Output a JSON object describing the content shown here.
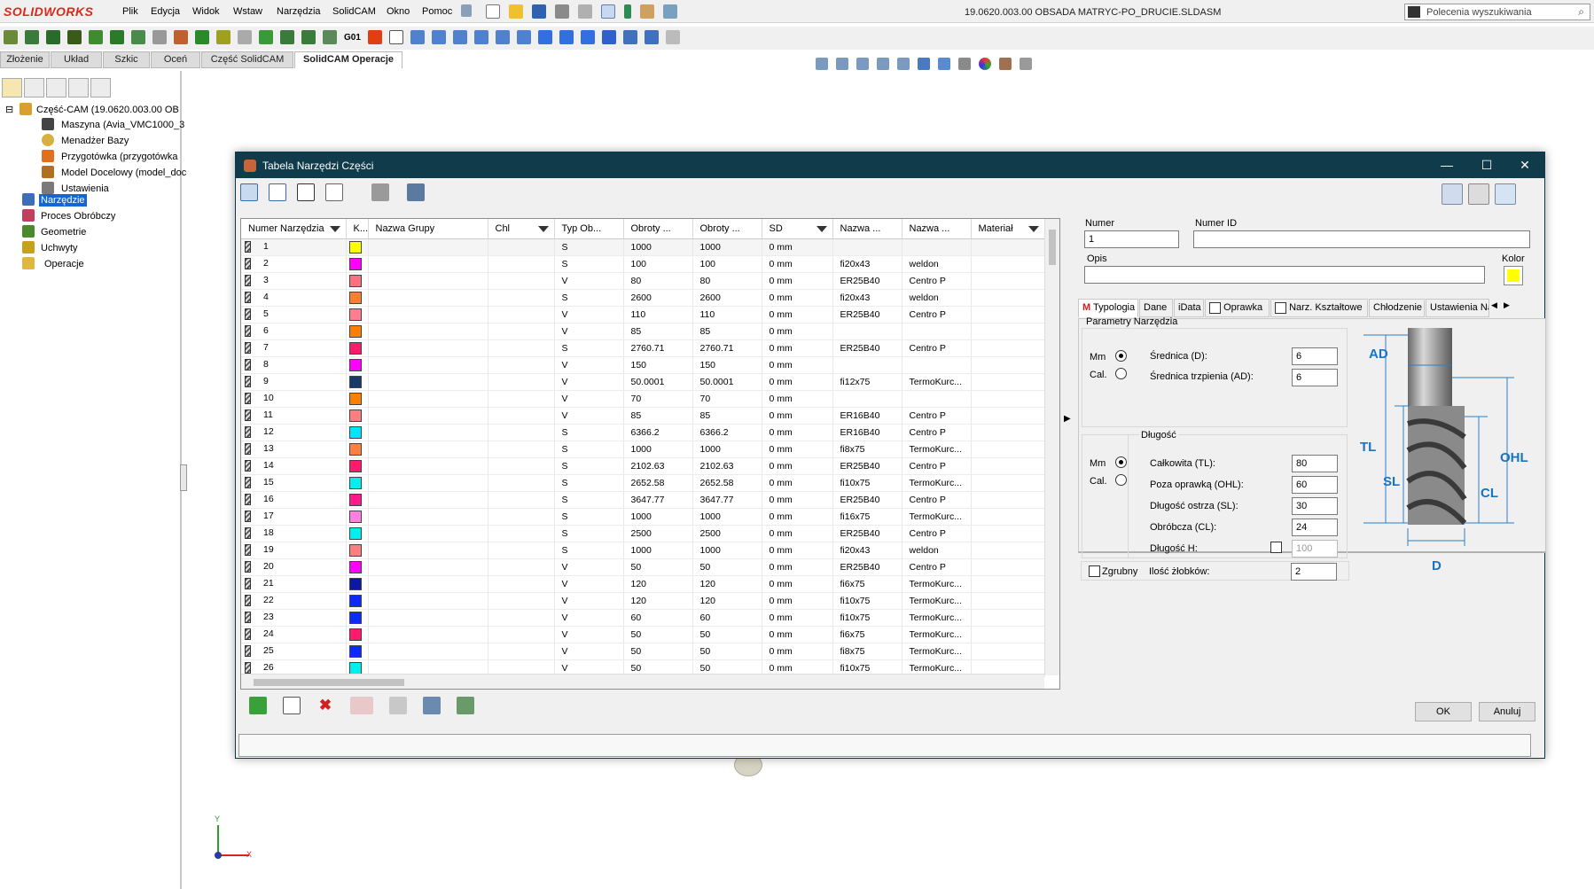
{
  "app": {
    "logo_text": "SOLIDWORKS",
    "menu": [
      "Plik",
      "Edycja",
      "Widok",
      "Wstaw",
      "Narzędzia",
      "SolidCAM",
      "Okno",
      "Pomoc"
    ],
    "document_title": "19.0620.003.00 OBSADA MATRYC-PO_DRUCIE.SLDASM",
    "search_placeholder": "Polecenia wyszukiwania",
    "toolbar_g01": "G01"
  },
  "command_tabs": [
    "Złożenie",
    "Układ",
    "Szkic",
    "Oceń",
    "Część SolidCAM",
    "SolidCAM Operacje"
  ],
  "command_tabs_active": "SolidCAM Operacje",
  "tree": {
    "root": "Część-CAM (19.0620.003.00 OB",
    "items": [
      {
        "label": "Maszyna (Avia_VMC1000_3",
        "icon": "machine-icon"
      },
      {
        "label": "Menadżer Bazy",
        "icon": "coordinate-system-icon"
      },
      {
        "label": "Przygotówka (przygotówka",
        "icon": "stock-icon"
      },
      {
        "label": "Model Docelowy (model_doc",
        "icon": "target-model-icon"
      },
      {
        "label": "Ustawienia",
        "icon": "settings-icon"
      }
    ],
    "top_items": [
      {
        "label": "Narzędzie",
        "icon": "tools-icon",
        "selected": true
      },
      {
        "label": "Proces Obróbczy",
        "icon": "process-icon"
      },
      {
        "label": "Geometrie",
        "icon": "geometry-icon"
      },
      {
        "label": "Uchwyty",
        "icon": "fixtures-icon"
      },
      {
        "label": "Operacje",
        "icon": "operations-folder-icon"
      }
    ]
  },
  "dialog": {
    "title": "Tabela Narzędzi Części",
    "columns": [
      "Numer Narzędzia",
      "K...",
      "Nazwa Grupy",
      "Chl",
      "Typ Ob...",
      "Obroty ...",
      "Obroty ...",
      "SD",
      "Nazwa ...",
      "Nazwa ...",
      "Materiał"
    ],
    "rows": [
      {
        "num": "1",
        "color": "#ffff00",
        "typ": "S",
        "o1": "1000",
        "o2": "1000",
        "sd": "0 mm",
        "n1": "",
        "n2": ""
      },
      {
        "num": "2",
        "color": "#ff00ff",
        "typ": "S",
        "o1": "100",
        "o2": "100",
        "sd": "0 mm",
        "n1": "fi20x43",
        "n2": "weldon"
      },
      {
        "num": "3",
        "color": "#ff7080",
        "typ": "V",
        "o1": "80",
        "o2": "80",
        "sd": "0 mm",
        "n1": "ER25B40",
        "n2": "Centro P"
      },
      {
        "num": "4",
        "color": "#ff7f30",
        "typ": "S",
        "o1": "2600",
        "o2": "2600",
        "sd": "0 mm",
        "n1": "fi20x43",
        "n2": "weldon"
      },
      {
        "num": "5",
        "color": "#ff7f90",
        "typ": "V",
        "o1": "110",
        "o2": "110",
        "sd": "0 mm",
        "n1": "ER25B40",
        "n2": "Centro P"
      },
      {
        "num": "6",
        "color": "#ff8000",
        "typ": "V",
        "o1": "85",
        "o2": "85",
        "sd": "0 mm",
        "n1": "",
        "n2": ""
      },
      {
        "num": "7",
        "color": "#ff1a6e",
        "typ": "S",
        "o1": "2760.71",
        "o2": "2760.71",
        "sd": "0 mm",
        "n1": "ER25B40",
        "n2": "Centro P"
      },
      {
        "num": "8",
        "color": "#ff00ff",
        "typ": "V",
        "o1": "150",
        "o2": "150",
        "sd": "0 mm",
        "n1": "",
        "n2": ""
      },
      {
        "num": "9",
        "color": "#173a6b",
        "typ": "V",
        "o1": "50.0001",
        "o2": "50.0001",
        "sd": "0 mm",
        "n1": "fi12x75",
        "n2": "TermoKurc..."
      },
      {
        "num": "10",
        "color": "#ff8000",
        "typ": "V",
        "o1": "70",
        "o2": "70",
        "sd": "0 mm",
        "n1": "",
        "n2": ""
      },
      {
        "num": "11",
        "color": "#ff7f80",
        "typ": "V",
        "o1": "85",
        "o2": "85",
        "sd": "0 mm",
        "n1": "ER16B40",
        "n2": "Centro P"
      },
      {
        "num": "12",
        "color": "#00e5ff",
        "typ": "S",
        "o1": "6366.2",
        "o2": "6366.2",
        "sd": "0 mm",
        "n1": "ER16B40",
        "n2": "Centro P"
      },
      {
        "num": "13",
        "color": "#ff8040",
        "typ": "S",
        "o1": "1000",
        "o2": "1000",
        "sd": "0 mm",
        "n1": "fi8x75",
        "n2": "TermoKurc..."
      },
      {
        "num": "14",
        "color": "#ff1a6e",
        "typ": "S",
        "o1": "2102.63",
        "o2": "2102.63",
        "sd": "0 mm",
        "n1": "ER25B40",
        "n2": "Centro P"
      },
      {
        "num": "15",
        "color": "#00f0f0",
        "typ": "S",
        "o1": "2652.58",
        "o2": "2652.58",
        "sd": "0 mm",
        "n1": "fi10x75",
        "n2": "TermoKurc..."
      },
      {
        "num": "16",
        "color": "#ff1a8c",
        "typ": "S",
        "o1": "3647.77",
        "o2": "3647.77",
        "sd": "0 mm",
        "n1": "ER25B40",
        "n2": "Centro P"
      },
      {
        "num": "17",
        "color": "#ff80e0",
        "typ": "S",
        "o1": "1000",
        "o2": "1000",
        "sd": "0 mm",
        "n1": "fi16x75",
        "n2": "TermoKurc..."
      },
      {
        "num": "18",
        "color": "#00f0f0",
        "typ": "S",
        "o1": "2500",
        "o2": "2500",
        "sd": "0 mm",
        "n1": "ER25B40",
        "n2": "Centro P"
      },
      {
        "num": "19",
        "color": "#ff7f80",
        "typ": "S",
        "o1": "1000",
        "o2": "1000",
        "sd": "0 mm",
        "n1": "fi20x43",
        "n2": "weldon"
      },
      {
        "num": "20",
        "color": "#ff00ff",
        "typ": "V",
        "o1": "50",
        "o2": "50",
        "sd": "0 mm",
        "n1": "ER25B40",
        "n2": "Centro P"
      },
      {
        "num": "21",
        "color": "#0a1a9e",
        "typ": "V",
        "o1": "120",
        "o2": "120",
        "sd": "0 mm",
        "n1": "fi6x75",
        "n2": "TermoKurc..."
      },
      {
        "num": "22",
        "color": "#0a2aff",
        "typ": "V",
        "o1": "120",
        "o2": "120",
        "sd": "0 mm",
        "n1": "fi10x75",
        "n2": "TermoKurc..."
      },
      {
        "num": "23",
        "color": "#0a2aff",
        "typ": "V",
        "o1": "60",
        "o2": "60",
        "sd": "0 mm",
        "n1": "fi10x75",
        "n2": "TermoKurc..."
      },
      {
        "num": "24",
        "color": "#ff1a6e",
        "typ": "V",
        "o1": "50",
        "o2": "50",
        "sd": "0 mm",
        "n1": "fi6x75",
        "n2": "TermoKurc..."
      },
      {
        "num": "25",
        "color": "#0a2aff",
        "typ": "V",
        "o1": "50",
        "o2": "50",
        "sd": "0 mm",
        "n1": "fi8x75",
        "n2": "TermoKurc..."
      },
      {
        "num": "26",
        "color": "#00f0f0",
        "typ": "V",
        "o1": "50",
        "o2": "50",
        "sd": "0 mm",
        "n1": "fi10x75",
        "n2": "TermoKurc..."
      }
    ],
    "fields": {
      "numer_label": "Numer",
      "numer_value": "1",
      "numer_id_label": "Numer ID",
      "numer_id_value": "",
      "opis_label": "Opis",
      "opis_value": "",
      "kolor_label": "Kolor",
      "kolor_value": "#ffff00"
    },
    "detail_tabs": [
      "Typologia",
      "Dane",
      "iData",
      "Oprawka",
      "Narz. Kształtowe",
      "Chłodzenie",
      "Ustawienia Na"
    ],
    "params": {
      "group_label": "Parametry Narzędzia",
      "mm_label": "Mm",
      "cal_label": "Cal.",
      "srednica_label": "Średnica (D):",
      "srednica_value": "6",
      "trzpien_label": "Średnica trzpienia (AD):",
      "trzpien_value": "6",
      "dlugosc_group": "Długość",
      "tl_label": "Całkowita (TL):",
      "tl_value": "80",
      "ohl_label": "Poza oprawką (OHL):",
      "ohl_value": "60",
      "sl_label": "Długość ostrza (SL):",
      "sl_value": "30",
      "cl_label": "Obróbcza (CL):",
      "cl_value": "24",
      "h_label": "Długość H:",
      "h_value": "100",
      "zgrubny_label": "Zgrubny",
      "zlobki_label": "Ilość żłobków:",
      "zlobki_value": "2"
    },
    "diagram_labels": {
      "ad": "AD",
      "tl": "TL",
      "sl": "SL",
      "cl": "CL",
      "ohl": "OHL",
      "d": "D"
    },
    "ok_label": "OK",
    "cancel_label": "Anuluj"
  },
  "axes": {
    "x": "X",
    "y": "Y"
  }
}
